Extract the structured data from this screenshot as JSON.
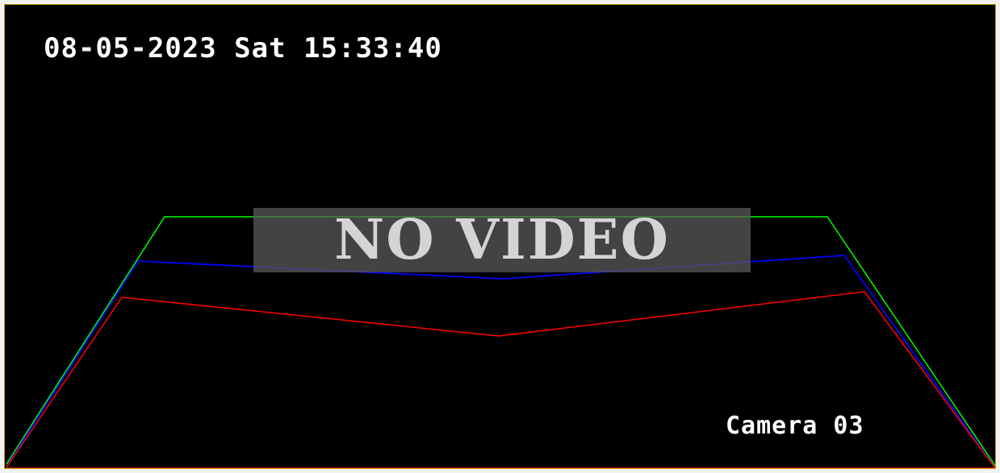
{
  "overlay": {
    "timestamp": "08-05-2023 Sat 15:33:40",
    "camera_label": "Camera 03",
    "no_video_text": "NO VIDEO"
  },
  "guide_lines": {
    "outer_color": "#00ff00",
    "middle_color": "#0000ff",
    "inner_color": "#ff0000"
  }
}
